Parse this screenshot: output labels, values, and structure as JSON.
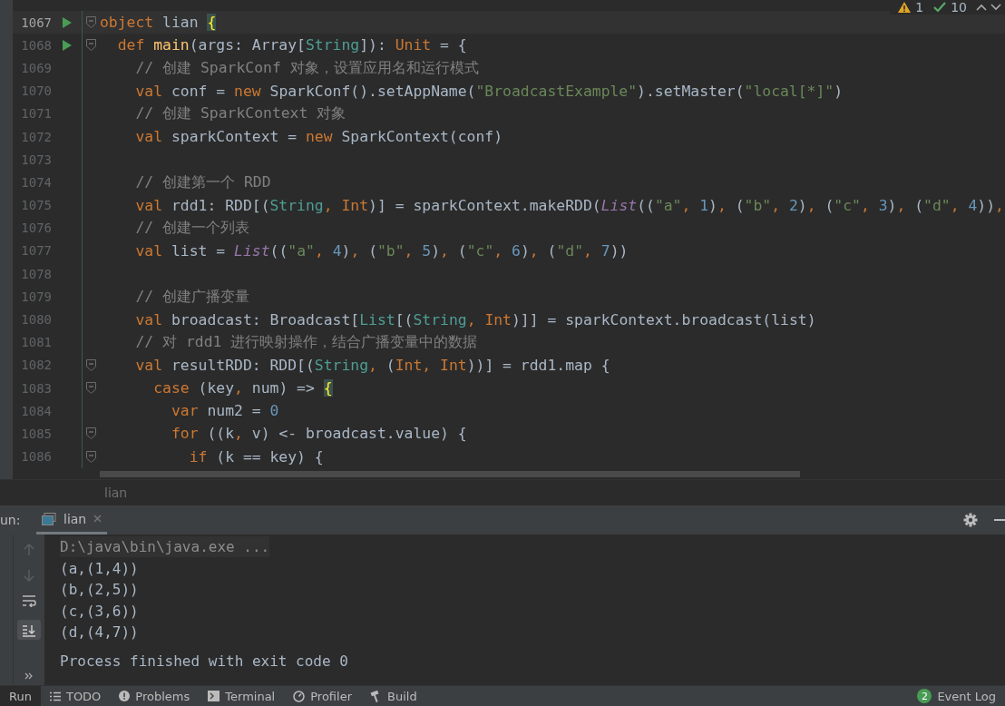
{
  "editor": {
    "lines": [
      {
        "number": "1067",
        "runnable": true,
        "fold": true,
        "current": true,
        "tokens": [
          {
            "kind": "kw",
            "text": "object"
          },
          {
            "kind": "plain",
            "text": " lian "
          },
          {
            "kind": "match",
            "text": "{"
          }
        ]
      },
      {
        "number": "1068",
        "runnable": true,
        "fold": true,
        "current": false,
        "tokens": [
          {
            "kind": "kw",
            "text": "  def"
          },
          {
            "kind": "fn",
            "text": " main"
          },
          {
            "kind": "plain",
            "text": "(args: Array["
          },
          {
            "kind": "type",
            "text": "String"
          },
          {
            "kind": "plain",
            "text": "]): "
          },
          {
            "kind": "kw",
            "text": "Unit"
          },
          {
            "kind": "plain",
            "text": " = {"
          }
        ]
      },
      {
        "number": "1069",
        "runnable": false,
        "fold": false,
        "current": false,
        "tokens": [
          {
            "kind": "comment",
            "text": "    // 创建 SparkConf 对象，设置应用名和运行模式"
          }
        ]
      },
      {
        "number": "1070",
        "runnable": false,
        "fold": false,
        "current": false,
        "tokens": [
          {
            "kind": "kw",
            "text": "    val"
          },
          {
            "kind": "plain",
            "text": " conf = "
          },
          {
            "kind": "kw",
            "text": "new"
          },
          {
            "kind": "plain",
            "text": " SparkConf().setAppName("
          },
          {
            "kind": "str",
            "text": "\"BroadcastExample\""
          },
          {
            "kind": "plain",
            "text": ").setMaster("
          },
          {
            "kind": "str",
            "text": "\"local[*]\""
          },
          {
            "kind": "plain",
            "text": ")"
          }
        ]
      },
      {
        "number": "1071",
        "runnable": false,
        "fold": false,
        "current": false,
        "tokens": [
          {
            "kind": "comment",
            "text": "    // 创建 SparkContext 对象"
          }
        ]
      },
      {
        "number": "1072",
        "runnable": false,
        "fold": false,
        "current": false,
        "tokens": [
          {
            "kind": "kw",
            "text": "    val"
          },
          {
            "kind": "plain",
            "text": " sparkContext = "
          },
          {
            "kind": "kw",
            "text": "new"
          },
          {
            "kind": "plain",
            "text": " SparkContext(conf)"
          }
        ]
      },
      {
        "number": "1073",
        "runnable": false,
        "fold": false,
        "current": false
      },
      {
        "number": "1074",
        "runnable": false,
        "fold": false,
        "current": false,
        "tokens": [
          {
            "kind": "comment",
            "text": "    // 创建第一个 RDD"
          }
        ]
      },
      {
        "number": "1075",
        "runnable": false,
        "fold": false,
        "current": false,
        "tokens": [
          {
            "kind": "kw",
            "text": "    val"
          },
          {
            "kind": "plain",
            "text": " rdd1: RDD[("
          },
          {
            "kind": "type",
            "text": "String"
          },
          {
            "kind": "kw",
            "text": ", Int"
          },
          {
            "kind": "plain",
            "text": ")] = sparkContext.makeRDD("
          },
          {
            "kind": "italic",
            "text": "List"
          },
          {
            "kind": "plain",
            "text": "(("
          },
          {
            "kind": "str",
            "text": "\"a\""
          },
          {
            "kind": "kw",
            "text": ", "
          },
          {
            "kind": "num",
            "text": "1"
          },
          {
            "kind": "plain",
            "text": ")"
          },
          {
            "kind": "kw",
            "text": ", "
          },
          {
            "kind": "plain",
            "text": "("
          },
          {
            "kind": "str",
            "text": "\"b\""
          },
          {
            "kind": "kw",
            "text": ", "
          },
          {
            "kind": "num",
            "text": "2"
          },
          {
            "kind": "plain",
            "text": ")"
          },
          {
            "kind": "kw",
            "text": ", "
          },
          {
            "kind": "plain",
            "text": "("
          },
          {
            "kind": "str",
            "text": "\"c\""
          },
          {
            "kind": "kw",
            "text": ", "
          },
          {
            "kind": "num",
            "text": "3"
          },
          {
            "kind": "plain",
            "text": ")"
          },
          {
            "kind": "kw",
            "text": ", "
          },
          {
            "kind": "plain",
            "text": "("
          },
          {
            "kind": "str",
            "text": "\"d\""
          },
          {
            "kind": "kw",
            "text": ", "
          },
          {
            "kind": "num",
            "text": "4"
          },
          {
            "kind": "plain",
            "text": "))"
          },
          {
            "kind": "kw",
            "text": ","
          }
        ]
      },
      {
        "number": "1076",
        "runnable": false,
        "fold": false,
        "current": false,
        "tokens": [
          {
            "kind": "comment",
            "text": "    // 创建一个列表"
          }
        ]
      },
      {
        "number": "1077",
        "runnable": false,
        "fold": false,
        "current": false,
        "tokens": [
          {
            "kind": "kw",
            "text": "    val"
          },
          {
            "kind": "plain",
            "text": " list = "
          },
          {
            "kind": "italic",
            "text": "List"
          },
          {
            "kind": "plain",
            "text": "(("
          },
          {
            "kind": "str",
            "text": "\"a\""
          },
          {
            "kind": "kw",
            "text": ", "
          },
          {
            "kind": "num",
            "text": "4"
          },
          {
            "kind": "plain",
            "text": ")"
          },
          {
            "kind": "kw",
            "text": ", "
          },
          {
            "kind": "plain",
            "text": "("
          },
          {
            "kind": "str",
            "text": "\"b\""
          },
          {
            "kind": "kw",
            "text": ", "
          },
          {
            "kind": "num",
            "text": "5"
          },
          {
            "kind": "plain",
            "text": ")"
          },
          {
            "kind": "kw",
            "text": ", "
          },
          {
            "kind": "plain",
            "text": "("
          },
          {
            "kind": "str",
            "text": "\"c\""
          },
          {
            "kind": "kw",
            "text": ", "
          },
          {
            "kind": "num",
            "text": "6"
          },
          {
            "kind": "plain",
            "text": ")"
          },
          {
            "kind": "kw",
            "text": ", "
          },
          {
            "kind": "plain",
            "text": "("
          },
          {
            "kind": "str",
            "text": "\"d\""
          },
          {
            "kind": "kw",
            "text": ", "
          },
          {
            "kind": "num",
            "text": "7"
          },
          {
            "kind": "plain",
            "text": "))"
          }
        ]
      },
      {
        "number": "1078",
        "runnable": false,
        "fold": false,
        "current": false
      },
      {
        "number": "1079",
        "runnable": false,
        "fold": false,
        "current": false,
        "tokens": [
          {
            "kind": "comment",
            "text": "    // 创建广播变量"
          }
        ]
      },
      {
        "number": "1080",
        "runnable": false,
        "fold": false,
        "current": false,
        "tokens": [
          {
            "kind": "kw",
            "text": "    val"
          },
          {
            "kind": "plain",
            "text": " broadcast: Broadcast["
          },
          {
            "kind": "type",
            "text": "List"
          },
          {
            "kind": "plain",
            "text": "[("
          },
          {
            "kind": "type",
            "text": "String"
          },
          {
            "kind": "kw",
            "text": ", Int"
          },
          {
            "kind": "plain",
            "text": ")]] = sparkContext.broadcast(list)"
          }
        ]
      },
      {
        "number": "1081",
        "runnable": false,
        "fold": false,
        "current": false,
        "tokens": [
          {
            "kind": "comment",
            "text": "    // 对 rdd1 进行映射操作，结合广播变量中的数据"
          }
        ]
      },
      {
        "number": "1082",
        "runnable": false,
        "fold": true,
        "current": false,
        "tokens": [
          {
            "kind": "kw",
            "text": "    val"
          },
          {
            "kind": "plain",
            "text": " resultRDD: RDD[("
          },
          {
            "kind": "type",
            "text": "String"
          },
          {
            "kind": "kw",
            "text": ", "
          },
          {
            "kind": "plain",
            "text": "("
          },
          {
            "kind": "kw",
            "text": "Int, Int"
          },
          {
            "kind": "plain",
            "text": "))] = rdd1.map {"
          }
        ]
      },
      {
        "number": "1083",
        "runnable": false,
        "fold": true,
        "current": false,
        "tokens": [
          {
            "kind": "kw",
            "text": "      case"
          },
          {
            "kind": "plain",
            "text": " (key"
          },
          {
            "kind": "kw",
            "text": ", "
          },
          {
            "kind": "plain",
            "text": "num) => "
          },
          {
            "kind": "match",
            "text": "{"
          }
        ]
      },
      {
        "number": "1084",
        "runnable": false,
        "fold": false,
        "current": false,
        "tokens": [
          {
            "kind": "kw",
            "text": "        var"
          },
          {
            "kind": "plain",
            "text": " num2 = "
          },
          {
            "kind": "num",
            "text": "0"
          }
        ]
      },
      {
        "number": "1085",
        "runnable": false,
        "fold": true,
        "current": false,
        "tokens": [
          {
            "kind": "kw",
            "text": "        for"
          },
          {
            "kind": "plain",
            "text": " ((k"
          },
          {
            "kind": "kw",
            "text": ", "
          },
          {
            "kind": "plain",
            "text": "v) <- broadcast.value) {"
          }
        ]
      },
      {
        "number": "1086",
        "runnable": false,
        "fold": true,
        "current": false,
        "tokens": [
          {
            "kind": "kw",
            "text": "          if"
          },
          {
            "kind": "plain",
            "text": " (k == key) {"
          }
        ]
      }
    ]
  },
  "inspection": {
    "warnings": "1",
    "checks": "10"
  },
  "breadcrumb": "lian",
  "run_panel": {
    "label": "un:",
    "tabs": [
      {
        "label": "lian",
        "selected": true
      }
    ],
    "output": [
      {
        "kind": "command",
        "text": "D:\\java\\bin\\java.exe ..."
      },
      {
        "kind": "stdout",
        "text": "(a,(1,4))"
      },
      {
        "kind": "stdout",
        "text": "(b,(2,5))"
      },
      {
        "kind": "stdout",
        "text": "(c,(3,6))"
      },
      {
        "kind": "stdout",
        "text": "(d,(4,7))"
      },
      {
        "kind": "exit",
        "text": "Process finished with exit code 0"
      }
    ]
  },
  "tool_windows": [
    {
      "label": "Run",
      "kind": "run",
      "selected": true
    },
    {
      "label": "TODO",
      "kind": "todo",
      "selected": false
    },
    {
      "label": "Problems",
      "kind": "problems",
      "selected": false
    },
    {
      "label": "Terminal",
      "kind": "terminal",
      "selected": false
    },
    {
      "label": "Profiler",
      "kind": "profiler",
      "selected": false
    },
    {
      "label": "Build",
      "kind": "build",
      "selected": false
    }
  ],
  "event_log": {
    "label": "Event Log",
    "badge": "2"
  }
}
